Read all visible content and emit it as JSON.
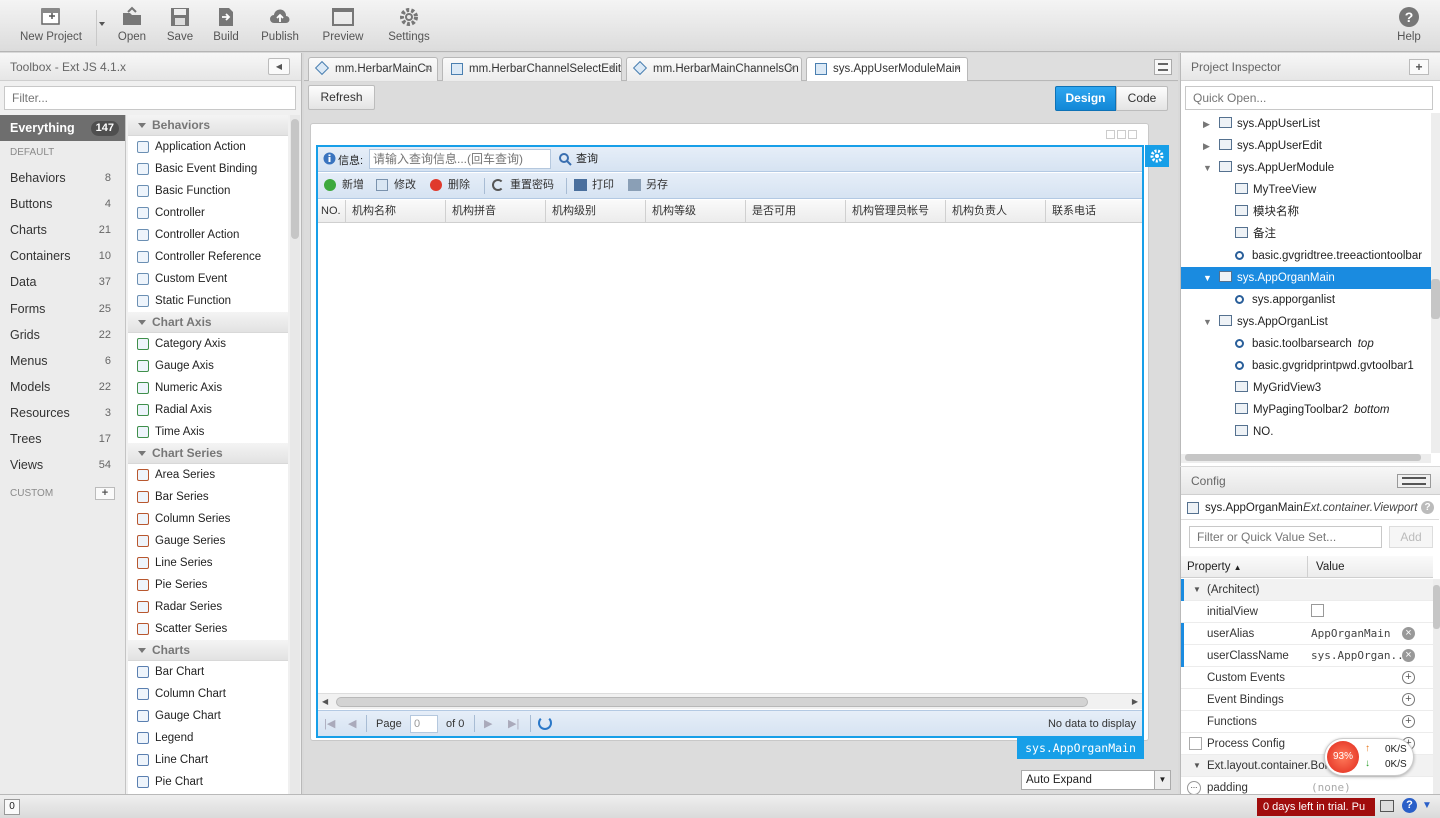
{
  "toolbar": {
    "new_project": "New Project",
    "open": "Open",
    "save": "Save",
    "build": "Build",
    "publish": "Publish",
    "preview": "Preview",
    "settings": "Settings",
    "help": "Help"
  },
  "toolbox": {
    "title": "Toolbox - Ext JS 4.1.x",
    "filter_placeholder": "Filter...",
    "categories": [
      {
        "label": "Everything",
        "count": "147"
      },
      {
        "label": "DEFAULT",
        "count": ""
      },
      {
        "label": "Behaviors",
        "count": "8"
      },
      {
        "label": "Buttons",
        "count": "4"
      },
      {
        "label": "Charts",
        "count": "21"
      },
      {
        "label": "Containers",
        "count": "10"
      },
      {
        "label": "Data",
        "count": "37"
      },
      {
        "label": "Forms",
        "count": "25"
      },
      {
        "label": "Grids",
        "count": "22"
      },
      {
        "label": "Menus",
        "count": "6"
      },
      {
        "label": "Models",
        "count": "22"
      },
      {
        "label": "Resources",
        "count": "3"
      },
      {
        "label": "Trees",
        "count": "17"
      },
      {
        "label": "Views",
        "count": "54"
      },
      {
        "label": "CUSTOM",
        "count": ""
      }
    ],
    "sections": [
      {
        "title": "Behaviors",
        "items": [
          "Application Action",
          "Basic Event Binding",
          "Basic Function",
          "Controller",
          "Controller Action",
          "Controller Reference",
          "Custom Event",
          "Static Function"
        ]
      },
      {
        "title": "Chart Axis",
        "items": [
          "Category Axis",
          "Gauge Axis",
          "Numeric Axis",
          "Radial Axis",
          "Time Axis"
        ]
      },
      {
        "title": "Chart Series",
        "items": [
          "Area Series",
          "Bar Series",
          "Column Series",
          "Gauge Series",
          "Line Series",
          "Pie Series",
          "Radar Series",
          "Scatter Series"
        ]
      },
      {
        "title": "Charts",
        "items": [
          "Bar Chart",
          "Column Chart",
          "Gauge Chart",
          "Legend",
          "Line Chart",
          "Pie Chart"
        ]
      }
    ]
  },
  "tabs": [
    "mm.HerbarMainCn",
    "mm.HerbarChannelSelectEdit",
    "mm.HerbarMainChannelsCn",
    "sys.AppUserModuleMain"
  ],
  "center": {
    "refresh": "Refresh",
    "design": "Design",
    "code": "Code",
    "search_label": "信息:",
    "search_placeholder": "请输入查询信息...(回车查询)",
    "search_btn": "查询",
    "actions": [
      "新增",
      "修改",
      "删除",
      "重置密码",
      "打印",
      "另存"
    ],
    "columns": [
      "NO.",
      "机构名称",
      "机构拼音",
      "机构级别",
      "机构等级",
      "是否可用",
      "机构管理员帐号",
      "机构负责人",
      "联系电话"
    ],
    "paging": {
      "page_label": "Page",
      "page_value": "0",
      "of": "of 0",
      "no_data": "No data to display"
    },
    "component_label": "sys.AppOrganMain",
    "auto_expand": "Auto Expand"
  },
  "inspector": {
    "title": "Project Inspector",
    "quick_open": "Quick Open...",
    "nodes": [
      {
        "label": "sys.AppUserList",
        "suffix": ""
      },
      {
        "label": "sys.AppUserEdit",
        "suffix": ""
      },
      {
        "label": "sys.AppUerModule",
        "suffix": ""
      },
      {
        "label": "MyTreeView",
        "suffix": ""
      },
      {
        "label": "模块名称",
        "suffix": ""
      },
      {
        "label": "备注",
        "suffix": ""
      },
      {
        "label": "basic.gvgridtree.treeactiontoolbar",
        "suffix": ""
      },
      {
        "label": "sys.AppOrganMain",
        "suffix": ""
      },
      {
        "label": "sys.apporganlist",
        "suffix": ""
      },
      {
        "label": "sys.AppOrganList",
        "suffix": ""
      },
      {
        "label": "basic.toolbarsearch",
        "suffix": "top"
      },
      {
        "label": "basic.gvgridprintpwd.gvtoolbar1",
        "suffix": ""
      },
      {
        "label": "MyGridView3",
        "suffix": ""
      },
      {
        "label": "MyPagingToolbar2",
        "suffix": "bottom"
      },
      {
        "label": "NO.",
        "suffix": ""
      }
    ]
  },
  "config": {
    "title": "Config",
    "component": "sys.AppOrganMain",
    "component_type": "Ext.container.Viewport",
    "filter_placeholder": "Filter or Quick Value Set...",
    "add": "Add",
    "col_property": "Property",
    "col_value": "Value",
    "rows": [
      {
        "key": "(Architect)",
        "value": ""
      },
      {
        "key": "initialView",
        "value": ""
      },
      {
        "key": "userAlias",
        "value": "AppOrganMain"
      },
      {
        "key": "userClassName",
        "value": "sys.AppOrgan..."
      },
      {
        "key": "Custom Events",
        "value": ""
      },
      {
        "key": "Event Bindings",
        "value": ""
      },
      {
        "key": "Functions",
        "value": ""
      },
      {
        "key": "Process Config",
        "value": ""
      },
      {
        "key": "Ext.layout.container.Bord",
        "value": ""
      },
      {
        "key": "padding",
        "value": "(none)"
      }
    ]
  },
  "status": {
    "zero": "0",
    "percent": "93%",
    "up": "0K/S",
    "down": "0K/S",
    "trial": "0 days left in trial. Pu"
  }
}
